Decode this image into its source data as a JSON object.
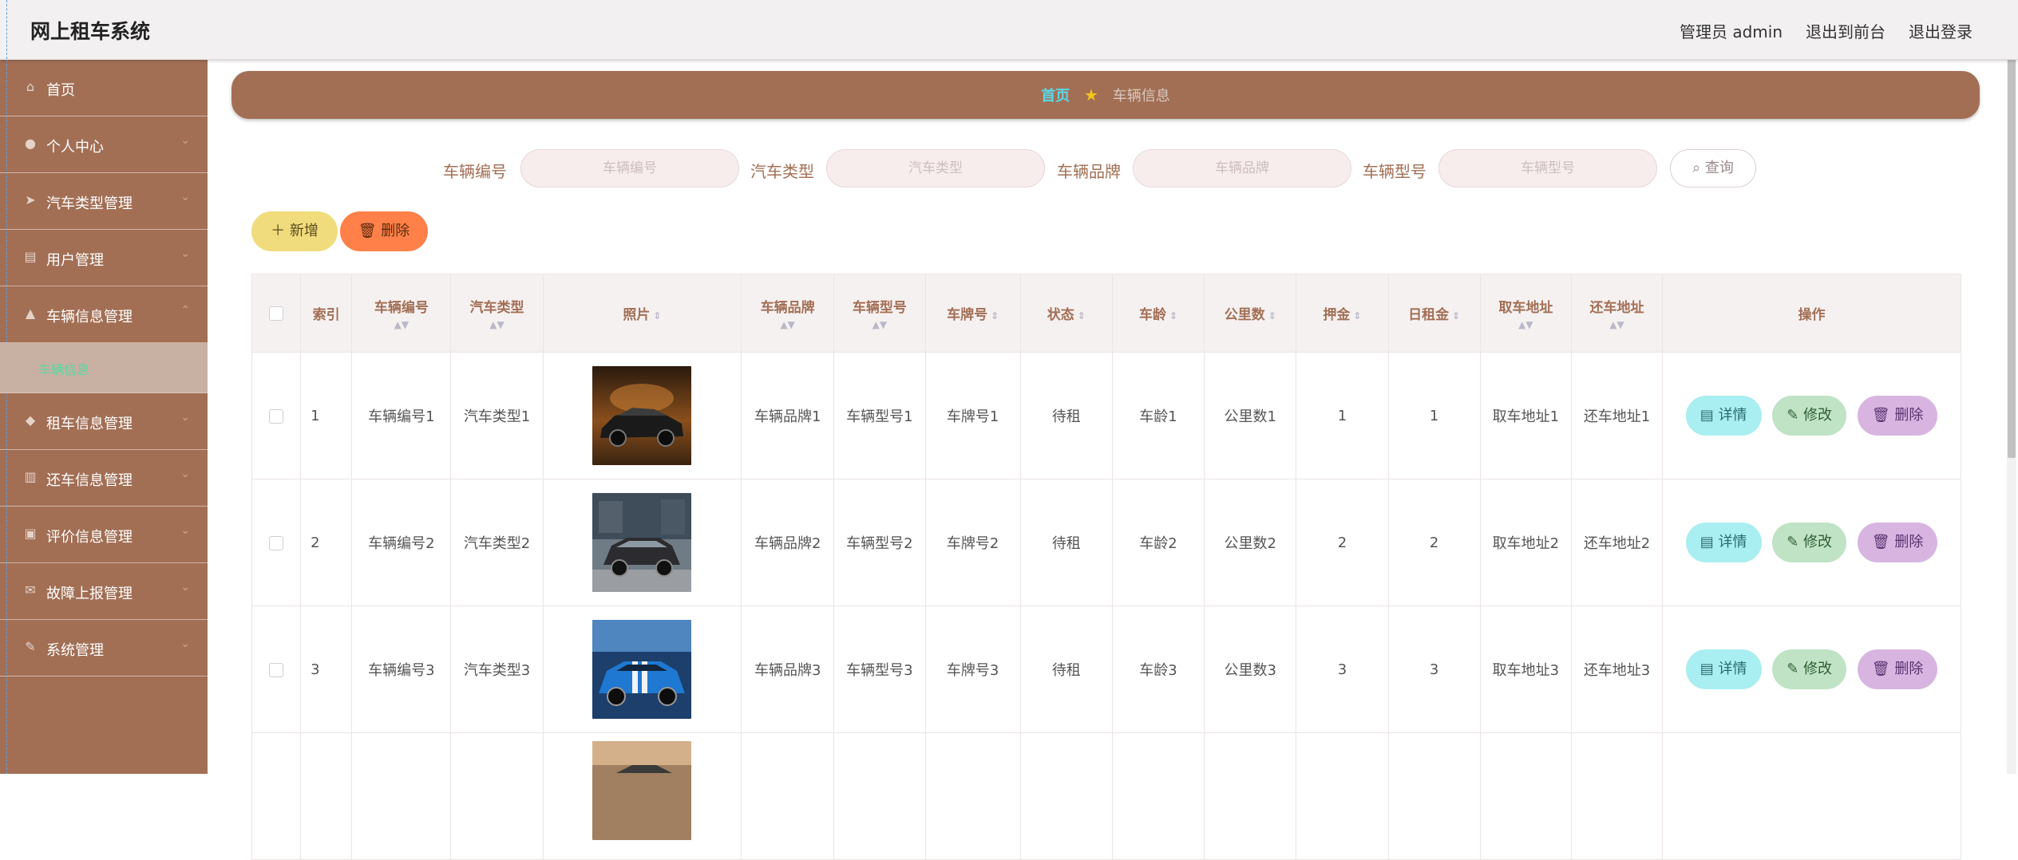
{
  "app": {
    "title": "网上租车系统"
  },
  "header_links": {
    "user": "管理员 admin",
    "frontend": "退出到前台",
    "logout": "退出登录"
  },
  "sidebar": {
    "items": [
      {
        "label": "首页",
        "icon": "home-icon",
        "glyph": "⌂"
      },
      {
        "label": "个人中心",
        "icon": "user-icon",
        "glyph": "●"
      },
      {
        "label": "汽车类型管理",
        "icon": "paper-plane-icon",
        "glyph": "➤"
      },
      {
        "label": "用户管理",
        "icon": "clipboard-icon",
        "glyph": "▤"
      },
      {
        "label": "车辆信息管理",
        "icon": "thumbs-up-icon",
        "glyph": "▲"
      },
      {
        "label": "租车信息管理",
        "icon": "location-pin-icon",
        "glyph": "◆"
      },
      {
        "label": "还车信息管理",
        "icon": "bar-chart-icon",
        "glyph": "▥"
      },
      {
        "label": "评价信息管理",
        "icon": "briefcase-icon",
        "glyph": "▣"
      },
      {
        "label": "故障上报管理",
        "icon": "mail-icon",
        "glyph": "✉"
      },
      {
        "label": "系统管理",
        "icon": "pen-icon",
        "glyph": "✎"
      }
    ],
    "active_sub": "车辆信息"
  },
  "breadcrumb": {
    "home": "首页",
    "current": "车辆信息"
  },
  "search": {
    "fields": [
      {
        "label": "车辆编号",
        "placeholder": "车辆编号"
      },
      {
        "label": "汽车类型",
        "placeholder": "汽车类型"
      },
      {
        "label": "车辆品牌",
        "placeholder": "车辆品牌"
      },
      {
        "label": "车辆型号",
        "placeholder": "车辆型号"
      }
    ],
    "query_label": "查询"
  },
  "actions": {
    "add_label": "新增",
    "delete_label": "删除"
  },
  "table": {
    "headers": {
      "index": "索引",
      "vehicle_no": "车辆编号",
      "car_type": "汽车类型",
      "photo": "照片",
      "brand": "车辆品牌",
      "model": "车辆型号",
      "plate": "车牌号",
      "status": "状态",
      "age": "车龄",
      "mileage": "公里数",
      "deposit": "押金",
      "daily_rent": "日租金",
      "pickup": "取车地址",
      "return_addr": "还车地址",
      "ops": "操作"
    },
    "rows": [
      {
        "index": "1",
        "vehicle_no": "车辆编号1",
        "car_type": "汽车类型1",
        "brand": "车辆品牌1",
        "model": "车辆型号1",
        "plate": "车牌号1",
        "status": "待租",
        "age": "车龄1",
        "mileage": "公里数1",
        "deposit": "1",
        "daily_rent": "1",
        "pickup": "取车地址1",
        "return_addr": "还车地址1"
      },
      {
        "index": "2",
        "vehicle_no": "车辆编号2",
        "car_type": "汽车类型2",
        "brand": "车辆品牌2",
        "model": "车辆型号2",
        "plate": "车牌号2",
        "status": "待租",
        "age": "车龄2",
        "mileage": "公里数2",
        "deposit": "2",
        "daily_rent": "2",
        "pickup": "取车地址2",
        "return_addr": "还车地址2"
      },
      {
        "index": "3",
        "vehicle_no": "车辆编号3",
        "car_type": "汽车类型3",
        "brand": "车辆品牌3",
        "model": "车辆型号3",
        "plate": "车牌号3",
        "status": "待租",
        "age": "车龄3",
        "mileage": "公里数3",
        "deposit": "3",
        "daily_rent": "3",
        "pickup": "取车地址3",
        "return_addr": "还车地址3"
      }
    ],
    "row_ops": {
      "detail": "详情",
      "edit": "修改",
      "delete": "删除"
    }
  },
  "colors": {
    "brand_brown": "#a26f55",
    "breadcrumb_home": "#59d9ea",
    "add_button": "#f0dc7c",
    "delete_button": "#ff8048",
    "detail_button": "#a9eef0",
    "edit_button": "#bfe3c4",
    "row_delete_button": "#d7b5e0"
  }
}
